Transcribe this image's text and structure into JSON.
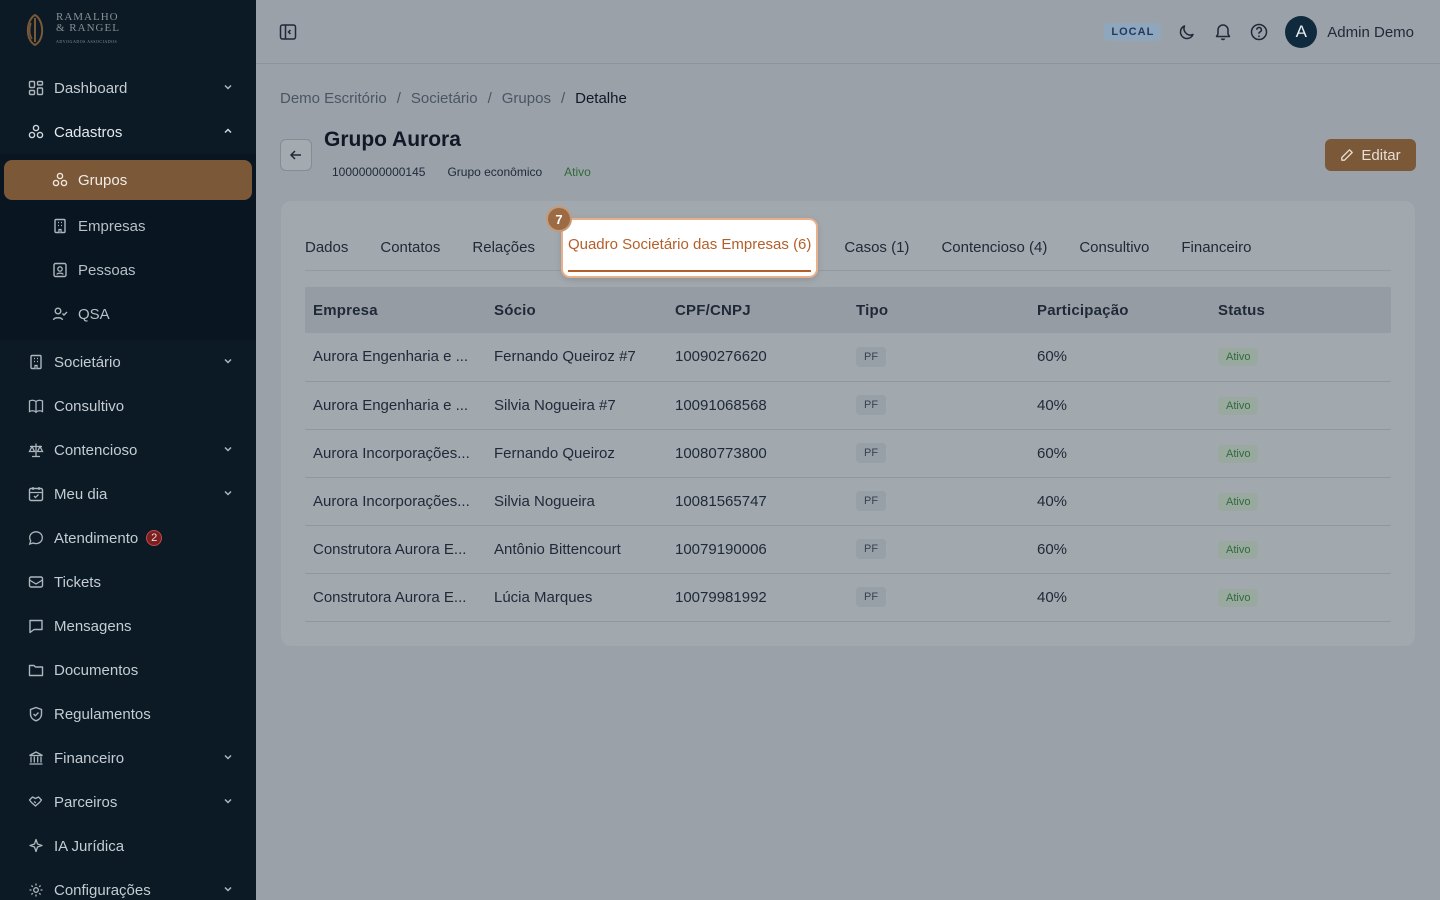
{
  "brand": {
    "line1": "RAMALHO",
    "line2": "& RANGEL",
    "tagline": "ADVOGADOS ASSOCIADOS"
  },
  "sidebar": {
    "items": [
      {
        "label": "Dashboard",
        "icon": "dashboard-icon",
        "chevron": "down"
      },
      {
        "label": "Cadastros",
        "icon": "cadastros-icon",
        "chevron": "up",
        "children": [
          {
            "label": "Grupos",
            "icon": "group-icon",
            "active": true
          },
          {
            "label": "Empresas",
            "icon": "building-icon"
          },
          {
            "label": "Pessoas",
            "icon": "person-card-icon"
          },
          {
            "label": "QSA",
            "icon": "user-check-icon"
          }
        ]
      },
      {
        "label": "Societário",
        "icon": "building-icon",
        "chevron": "down"
      },
      {
        "label": "Consultivo",
        "icon": "book-icon"
      },
      {
        "label": "Contencioso",
        "icon": "scale-icon",
        "chevron": "down"
      },
      {
        "label": "Meu dia",
        "icon": "calendar-icon",
        "chevron": "down"
      },
      {
        "label": "Atendimento",
        "icon": "chat-icon",
        "badge": "2"
      },
      {
        "label": "Tickets",
        "icon": "ticket-icon"
      },
      {
        "label": "Mensagens",
        "icon": "message-icon"
      },
      {
        "label": "Documentos",
        "icon": "folder-icon"
      },
      {
        "label": "Regulamentos",
        "icon": "shield-icon"
      },
      {
        "label": "Financeiro",
        "icon": "bank-icon",
        "chevron": "down"
      },
      {
        "label": "Parceiros",
        "icon": "handshake-icon",
        "chevron": "down"
      },
      {
        "label": "IA Jurídica",
        "icon": "sparkle-icon"
      },
      {
        "label": "Configurações",
        "icon": "gear-icon",
        "chevron": "down"
      }
    ]
  },
  "topbar": {
    "env": "LOCAL",
    "user_initial": "A",
    "user_name": "Admin Demo"
  },
  "breadcrumb": [
    "Demo Escritório",
    "Societário",
    "Grupos",
    "Detalhe"
  ],
  "header": {
    "title": "Grupo Aurora",
    "code": "10000000000145",
    "type": "Grupo econômico",
    "status": "Ativo",
    "edit_label": "Editar"
  },
  "tour": {
    "step": "7"
  },
  "tabs": [
    "Dados",
    "Contatos",
    "Relações",
    "Quadro Societário das Empresas (6)",
    "Casos (1)",
    "Contencioso (4)",
    "Consultivo",
    "Financeiro"
  ],
  "table": {
    "columns": [
      "Empresa",
      "Sócio",
      "CPF/CNPJ",
      "Tipo",
      "Participação",
      "Status"
    ],
    "rows": [
      [
        "Aurora Engenharia e ...",
        "Fernando Queiroz #7",
        "10090276620",
        "PF",
        "60%",
        "Ativo"
      ],
      [
        "Aurora Engenharia e ...",
        "Silvia Nogueira #7",
        "10091068568",
        "PF",
        "40%",
        "Ativo"
      ],
      [
        "Aurora Incorporações...",
        "Fernando Queiroz",
        "10080773800",
        "PF",
        "60%",
        "Ativo"
      ],
      [
        "Aurora Incorporações...",
        "Silvia Nogueira",
        "10081565747",
        "PF",
        "40%",
        "Ativo"
      ],
      [
        "Construtora Aurora E...",
        "Antônio Bittencourt",
        "10079190006",
        "PF",
        "60%",
        "Ativo"
      ],
      [
        "Construtora Aurora E...",
        "Lúcia Marques",
        "10079981992",
        "PF",
        "40%",
        "Ativo"
      ]
    ]
  },
  "colors": {
    "accent": "#7a5838",
    "sidebar_bg": "#0b1a24",
    "overlay": "#9aa1a8",
    "highlight_text": "#b45f2a",
    "success": "#2f6b3a"
  }
}
